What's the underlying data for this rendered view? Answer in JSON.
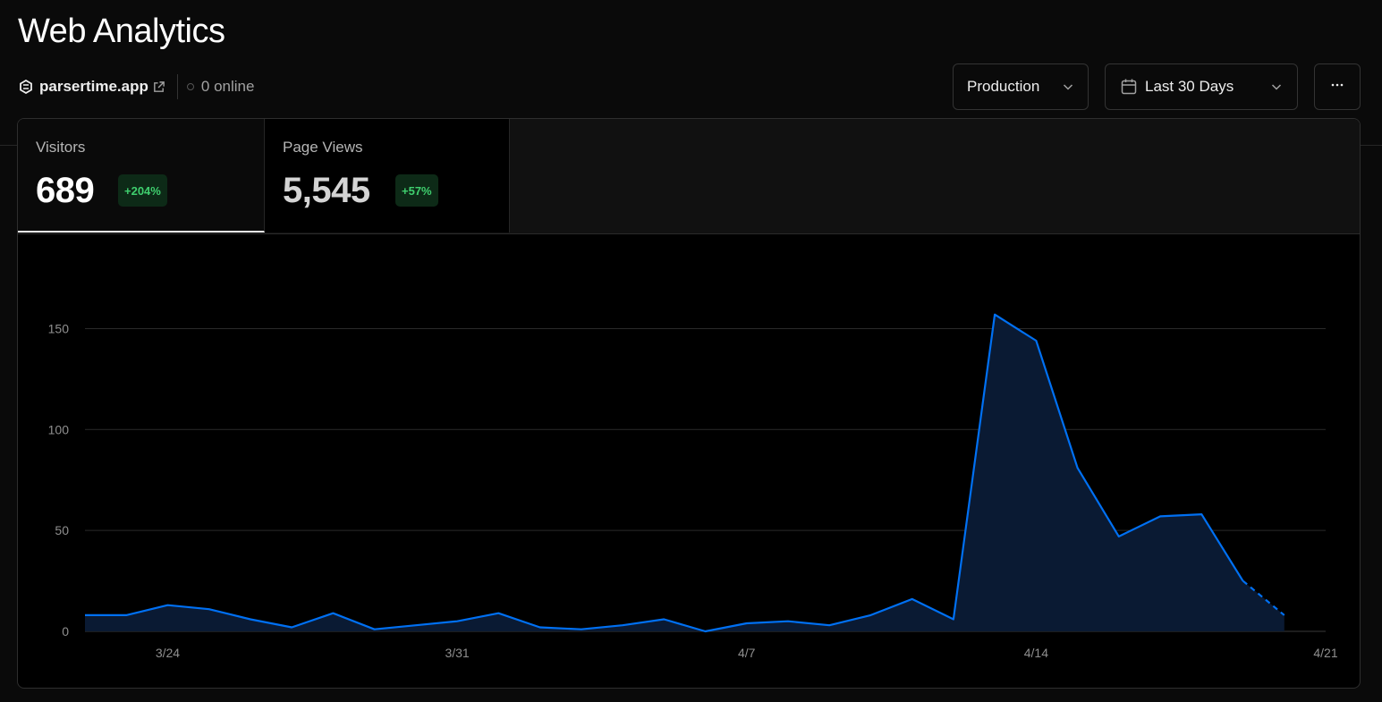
{
  "header": {
    "title": "Web Analytics",
    "project": {
      "name": "parsertime.app",
      "logo_icon": "project-logo-icon",
      "external_icon": "external-link-icon"
    },
    "online": {
      "text": "0 online",
      "status_color": "#555555"
    }
  },
  "controls": {
    "environment": {
      "label": "Production",
      "icon": "chevron-down-icon"
    },
    "date_range": {
      "label": "Last 30 Days",
      "icon": "calendar-icon"
    },
    "more": {
      "icon": "more-horizontal-icon"
    }
  },
  "tabs": [
    {
      "label": "Visitors",
      "value": "689",
      "delta": "+204%",
      "selected": true
    },
    {
      "label": "Page Views",
      "value": "5,545",
      "delta": "+57%",
      "selected": false
    }
  ],
  "colors": {
    "accent": "#0070f3",
    "positive": "#3fcf6e",
    "area_fill": "#0a1a33"
  },
  "chart_data": {
    "type": "area",
    "x": [
      "3/22",
      "3/23",
      "3/24",
      "3/25",
      "3/26",
      "3/27",
      "3/28",
      "3/29",
      "3/30",
      "3/31",
      "4/1",
      "4/2",
      "4/3",
      "4/4",
      "4/5",
      "4/6",
      "4/7",
      "4/8",
      "4/9",
      "4/10",
      "4/11",
      "4/12",
      "4/13",
      "4/14",
      "4/15",
      "4/16",
      "4/17",
      "4/18",
      "4/19",
      "4/20",
      "4/21"
    ],
    "values": [
      8,
      8,
      13,
      11,
      6,
      2,
      9,
      1,
      3,
      5,
      9,
      2,
      1,
      3,
      6,
      0,
      4,
      5,
      3,
      8,
      16,
      6,
      157,
      144,
      81,
      47,
      57,
      58,
      25,
      8
    ],
    "partial_last": true,
    "x_ticks": [
      "3/24",
      "3/31",
      "4/7",
      "4/14",
      "4/21"
    ],
    "y_ticks": [
      0,
      50,
      100,
      150
    ],
    "ylim": [
      0,
      160
    ],
    "grid": true
  }
}
